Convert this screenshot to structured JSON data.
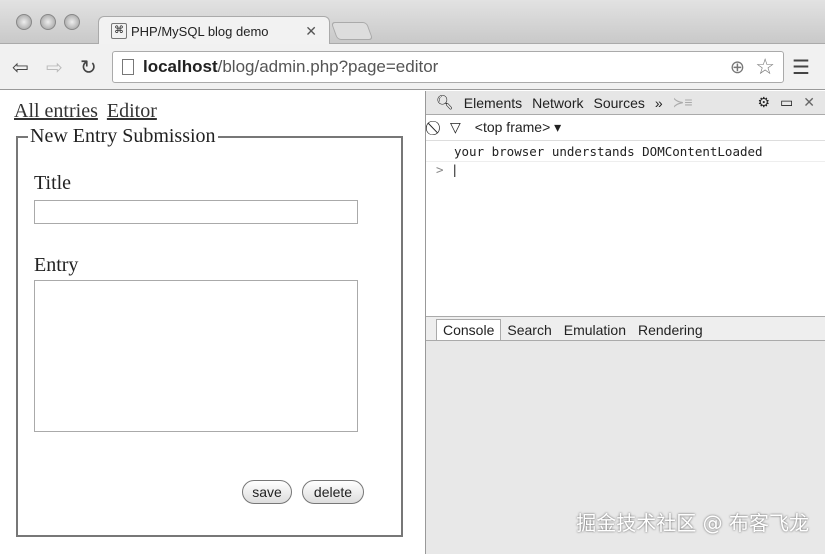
{
  "browser": {
    "tab_title": "PHP/MySQL blog demo",
    "url_host": "localhost",
    "url_path": "/blog/admin.php?page=editor"
  },
  "page": {
    "links": [
      "All entries",
      "Editor"
    ],
    "legend": "New Entry Submission",
    "title_label": "Title",
    "title_value": "",
    "entry_label": "Entry",
    "entry_value": "",
    "save": "save",
    "delete": "delete"
  },
  "devtools": {
    "tabs": [
      "Elements",
      "Network",
      "Sources"
    ],
    "more": "»",
    "frame": "<top frame>",
    "log": "your browser understands DOMContentLoaded",
    "prompt": ">",
    "drawer_tabs": [
      "Console",
      "Search",
      "Emulation",
      "Rendering"
    ]
  },
  "watermark": "掘金技术社区 @ 布客飞龙"
}
